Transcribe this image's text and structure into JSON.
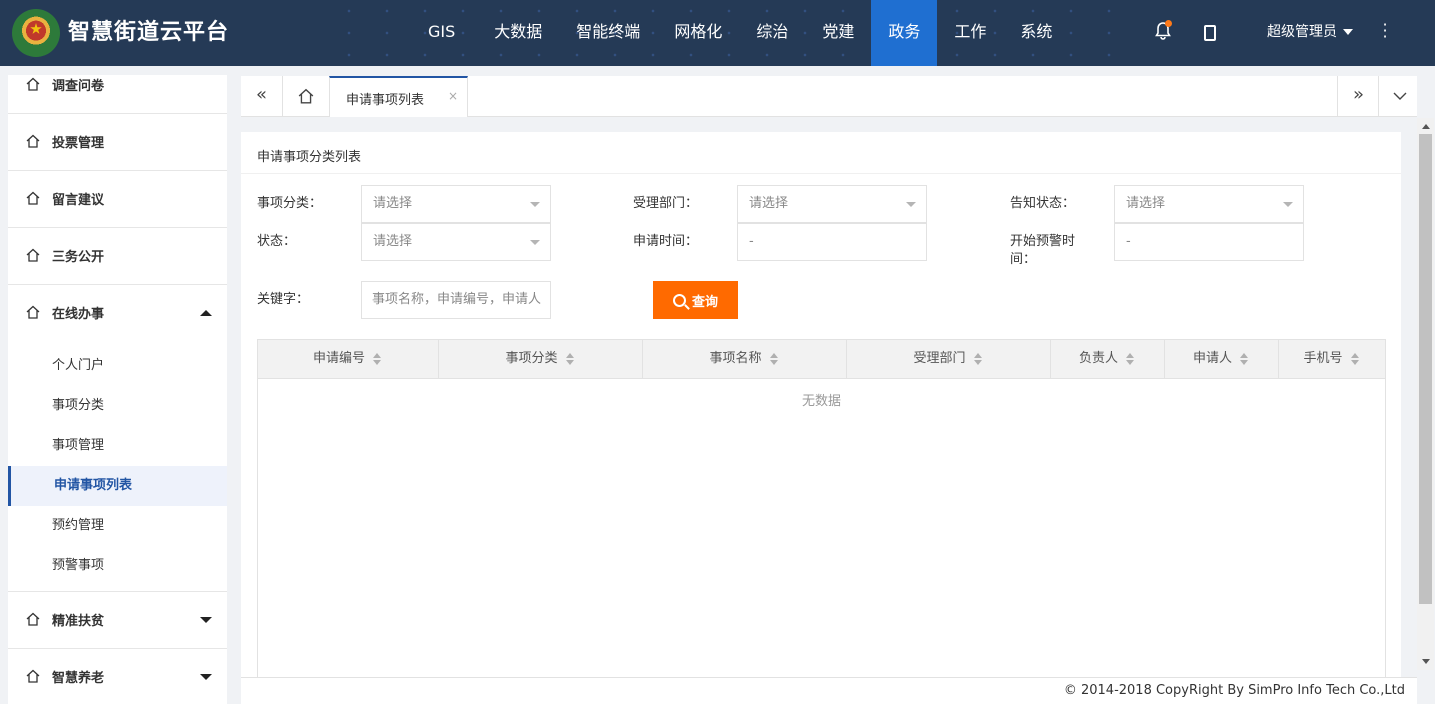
{
  "app": {
    "title": "智慧街道云平台"
  },
  "nav": {
    "items": [
      "GIS",
      "大数据",
      "智能终端",
      "网格化",
      "综治",
      "党建",
      "政务",
      "工作",
      "系统"
    ],
    "active": "政务"
  },
  "user": {
    "name": "超级管理员"
  },
  "sidebar": {
    "groups_top": [
      "调查问卷",
      "投票管理",
      "留言建议",
      "三务公开"
    ],
    "open_group": "在线办事",
    "sub_items": [
      "个人门户",
      "事项分类",
      "事项管理",
      "申请事项列表",
      "预约管理",
      "预警事项"
    ],
    "active_sub": "申请事项列表",
    "groups_bottom": [
      "精准扶贫",
      "智慧养老"
    ]
  },
  "tabs": {
    "current": "申请事项列表",
    "close": "×"
  },
  "panel": {
    "title": "申请事项分类列表",
    "filters": {
      "category_label": "事项分类：",
      "dept_label": "受理部门：",
      "notify_label": "告知状态：",
      "status_label": "状态：",
      "apply_time_label": "申请时间：",
      "warn_time_label": "开始预警时间：",
      "keyword_label": "关键字：",
      "select_placeholder": "请选择",
      "date_placeholder": "-",
      "keyword_placeholder": "事项名称，申请编号，申请人"
    },
    "search_button": "查询"
  },
  "table": {
    "columns": [
      "申请编号",
      "事项分类",
      "事项名称",
      "受理部门",
      "负责人",
      "申请人",
      "手机号"
    ],
    "empty_text": "无数据"
  },
  "footer": {
    "copyright": "© 2014-2018 CopyRight By SimPro Info Tech Co.,Ltd"
  },
  "colors": {
    "topbar": "#253a56",
    "nav_active": "#1f6fd1",
    "accent": "#2255a4",
    "search_button": "#ff6a00"
  },
  "icons": [
    "logo-emblem",
    "bell-icon",
    "phone-icon",
    "more-icon",
    "home-icon",
    "double-left-icon",
    "double-right-icon",
    "chevron-down-icon",
    "search-icon",
    "sort-icon"
  ]
}
